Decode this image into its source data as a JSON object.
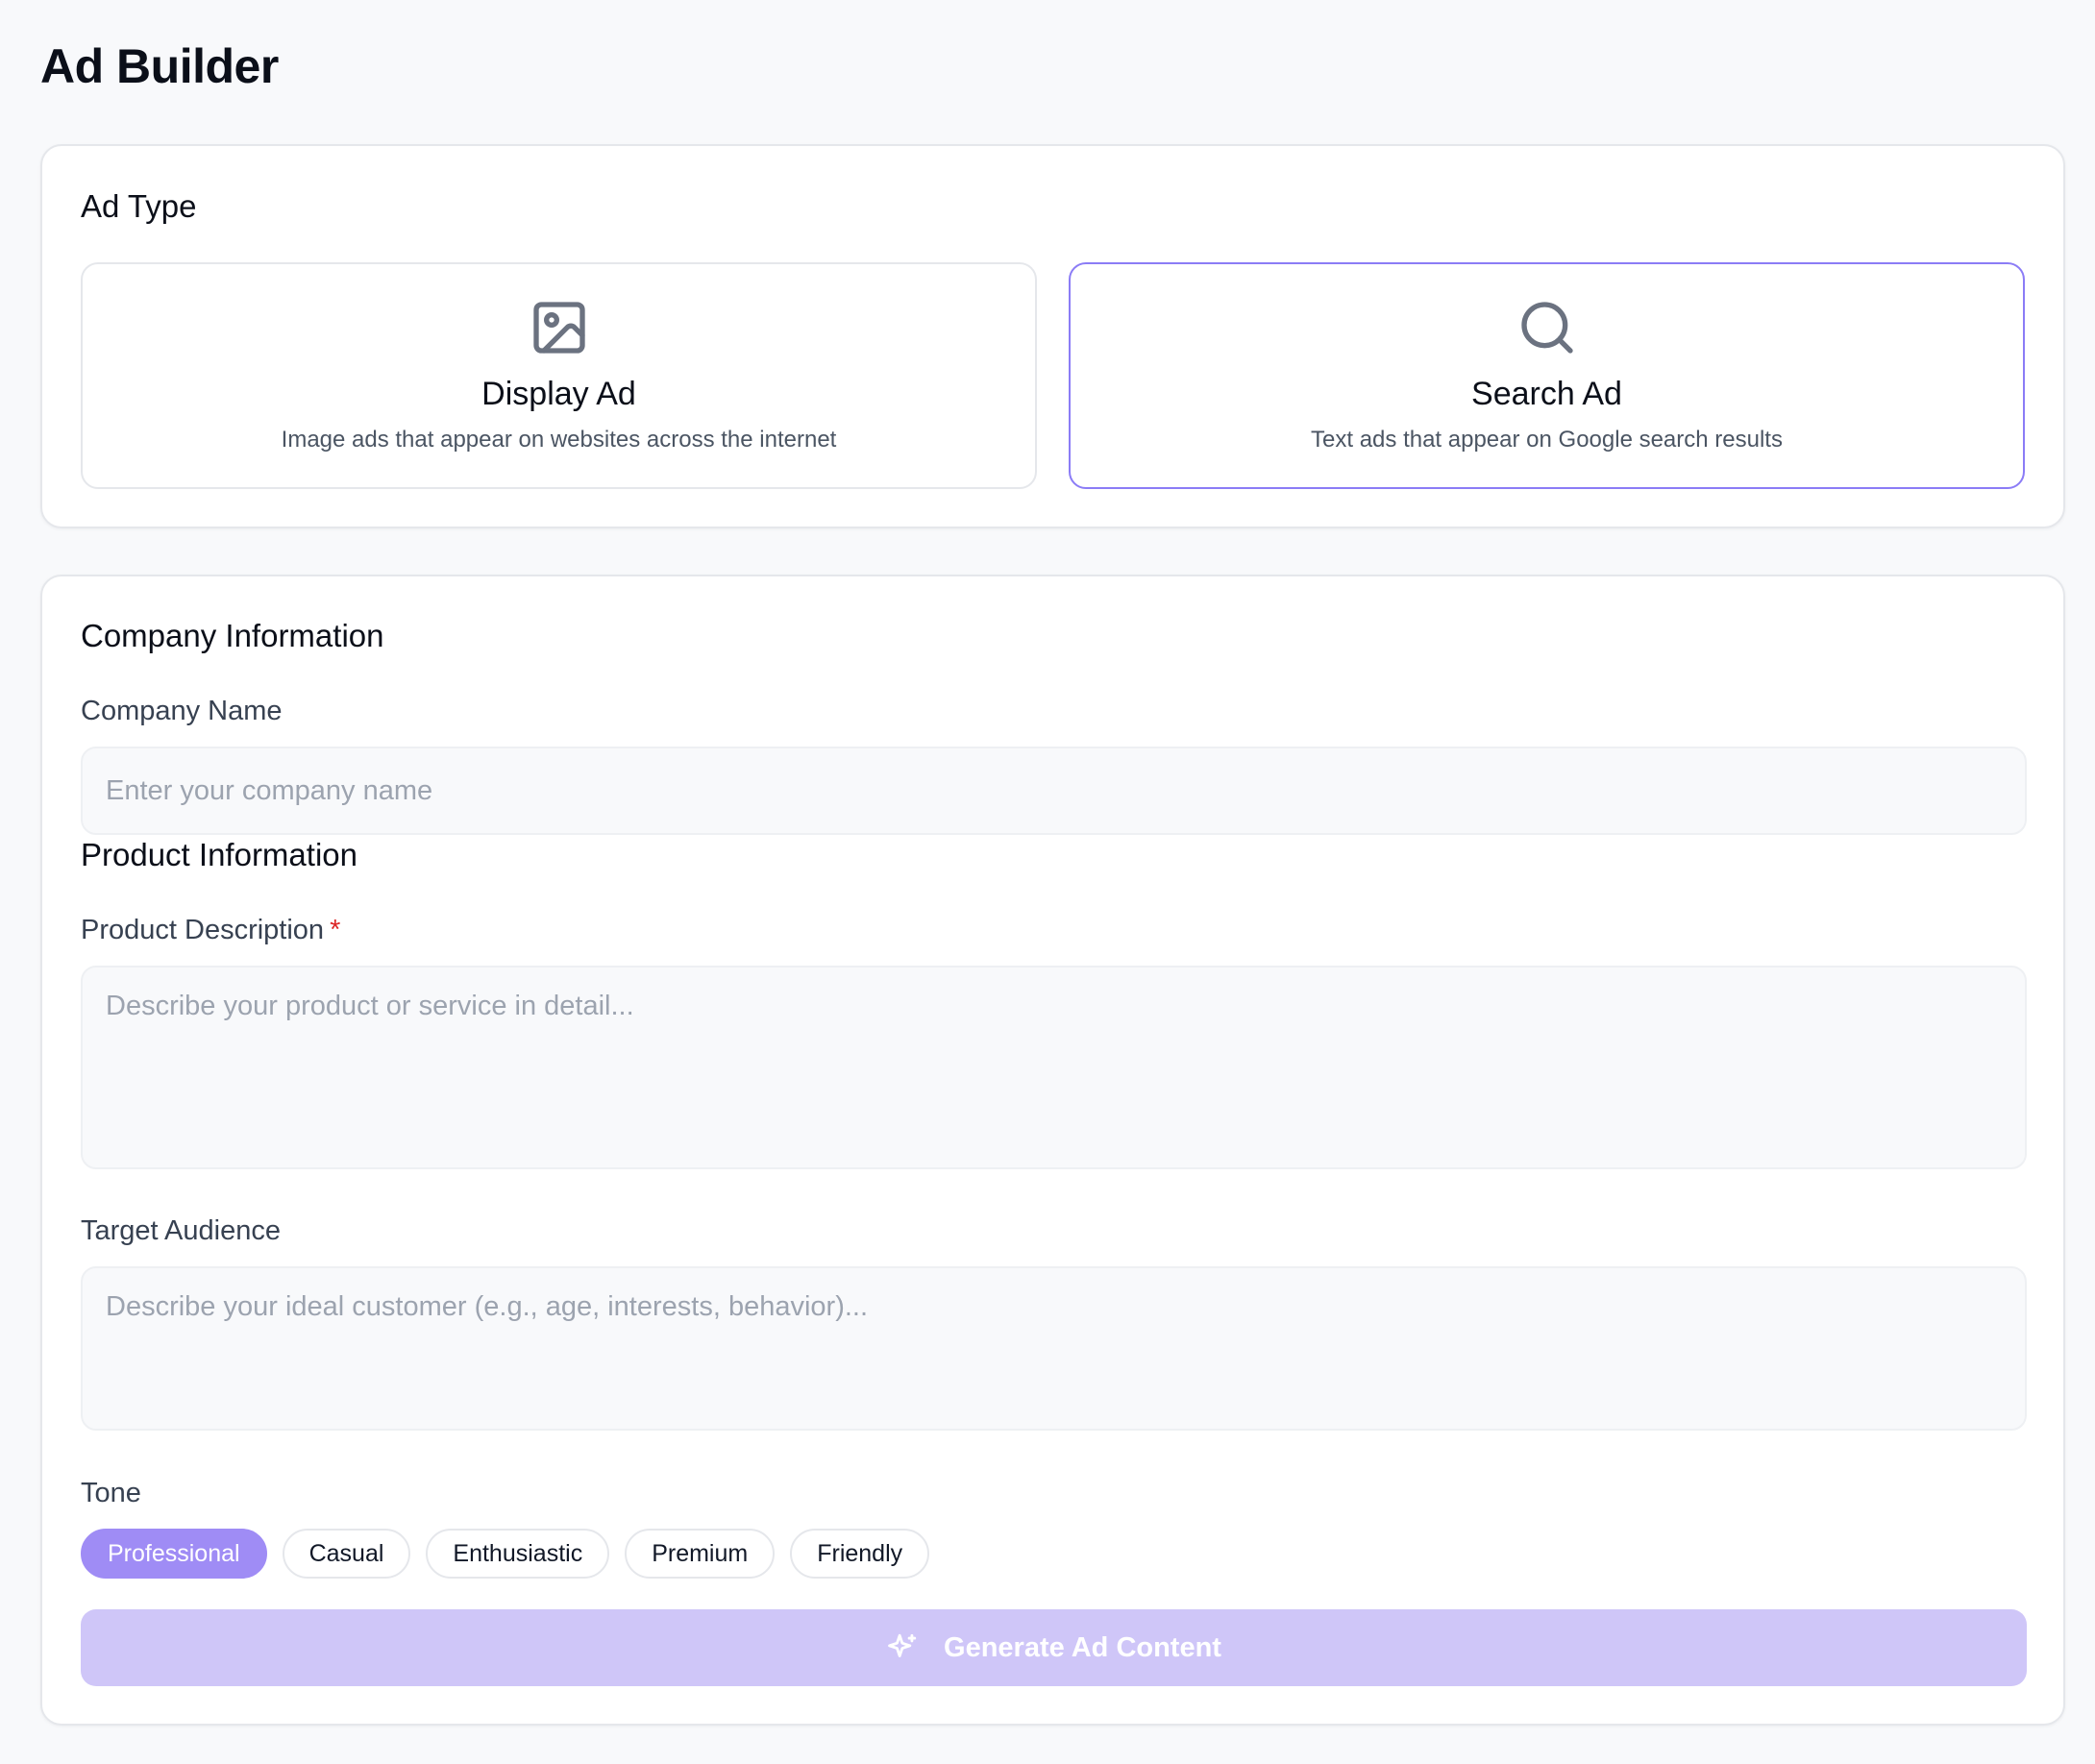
{
  "page": {
    "title": "Ad Builder"
  },
  "ad_type": {
    "section_title": "Ad Type",
    "options": [
      {
        "title": "Display Ad",
        "description": "Image ads that appear on websites across the internet",
        "icon": "image-icon",
        "selected": false
      },
      {
        "title": "Search Ad",
        "description": "Text ads that appear on Google search results",
        "icon": "search-icon",
        "selected": true
      }
    ]
  },
  "company": {
    "section_title": "Company Information",
    "name_label": "Company Name",
    "name_placeholder": "Enter your company name",
    "name_value": ""
  },
  "product": {
    "section_title": "Product Information",
    "description_label": "Product Description",
    "required_mark": "*",
    "description_placeholder": "Describe your product or service in detail...",
    "audience_label": "Target Audience",
    "audience_placeholder": "Describe your ideal customer (e.g., age, interests, behavior)..."
  },
  "tone": {
    "label": "Tone",
    "options": [
      "Professional",
      "Casual",
      "Enthusiastic",
      "Premium",
      "Friendly"
    ],
    "selected": "Professional"
  },
  "actions": {
    "generate_label": "Generate Ad Content",
    "generate_icon": "sparkles-icon"
  },
  "colors": {
    "accent": "#9f8cf5",
    "accent_disabled": "#cfc6f8",
    "selected_border": "#8b7cf6",
    "required": "#dc2626"
  }
}
